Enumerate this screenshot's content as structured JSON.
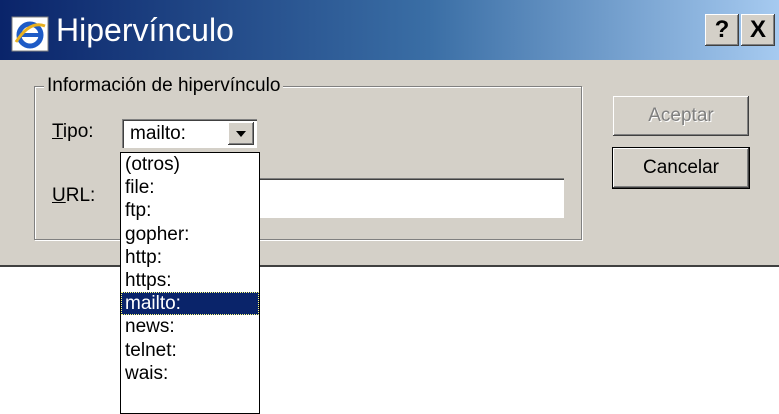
{
  "window": {
    "title": "Hipervínculo",
    "help_label": "?",
    "close_label": "X",
    "icon": "internet-explorer-icon"
  },
  "group": {
    "label": "Información de hipervínculo"
  },
  "fields": {
    "tipo_label": "Tipo:",
    "tipo_value": "mailto:",
    "url_label": "URL:",
    "url_value": ""
  },
  "buttons": {
    "ok_label": "Aceptar",
    "cancel_label": "Cancelar"
  },
  "dropdown": {
    "options": [
      "(otros)",
      "file:",
      "ftp:",
      "gopher:",
      "http:",
      "https:",
      "mailto:",
      "news:",
      "telnet:",
      "wais:"
    ],
    "selected": "mailto:"
  },
  "colors": {
    "titlebar_start": "#0a246a",
    "titlebar_end": "#a6caf0",
    "selection": "#0a246a",
    "face": "#d4d0c8"
  }
}
